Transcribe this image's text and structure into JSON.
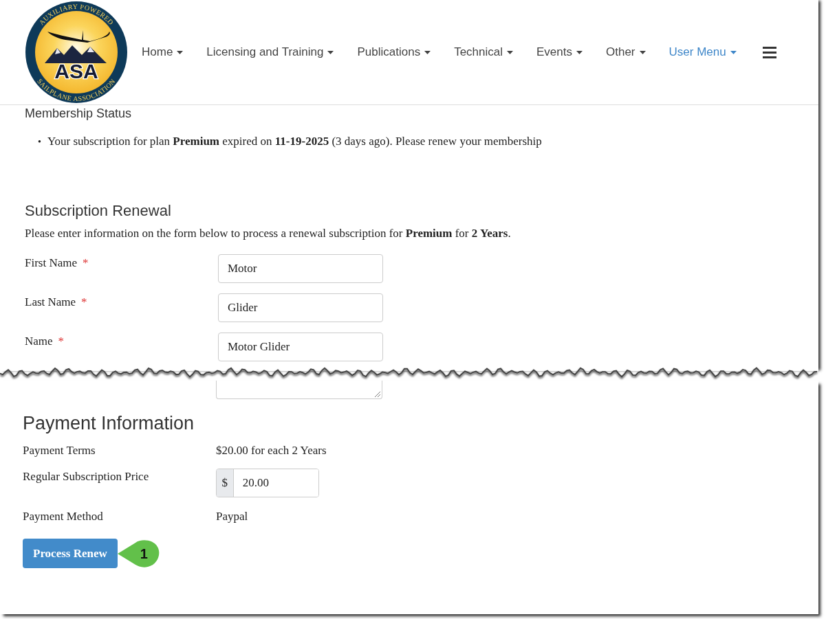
{
  "logo": {
    "top_text": "AUXILIARY POWERED",
    "bottom_text": "SAILPLANE ASSOCIATION",
    "initials": "ASA"
  },
  "nav": {
    "items": [
      {
        "label": "Home",
        "selected": false
      },
      {
        "label": "Licensing and Training",
        "selected": false
      },
      {
        "label": "Publications",
        "selected": false
      },
      {
        "label": "Technical",
        "selected": false
      },
      {
        "label": "Events",
        "selected": false
      },
      {
        "label": "Other",
        "selected": false
      },
      {
        "label": "User Menu",
        "selected": true
      }
    ]
  },
  "membership": {
    "title": "Membership Status",
    "bullet": "•",
    "items": [
      "Your subscription for plan **Premium** expired on **11-19-2025** (3 days ago). Please renew your membership"
    ]
  },
  "renewal": {
    "title": "Subscription Renewal",
    "intro": "Please enter information on the form below to process a renewal subscription for **Premium** for **2 Years**.",
    "fields": [
      {
        "label": "First Name",
        "required_mark": "*",
        "value": "Motor"
      },
      {
        "label": "Last Name",
        "required_mark": "*",
        "value": "Glider"
      },
      {
        "label": "Name",
        "required_mark": "*",
        "value": "Motor Glider"
      }
    ]
  },
  "payment": {
    "title": "Payment Information",
    "rows": [
      {
        "kind": "text",
        "label": "Payment Terms",
        "value": "$20.00 for each 2 Years"
      },
      {
        "kind": "price",
        "label": "Regular Subscription Price",
        "addon": "$",
        "value": "20.00"
      },
      {
        "kind": "text",
        "label": "Payment Method",
        "value": "Paypal"
      }
    ],
    "submit": "Process Renew",
    "callout": "1"
  }
}
